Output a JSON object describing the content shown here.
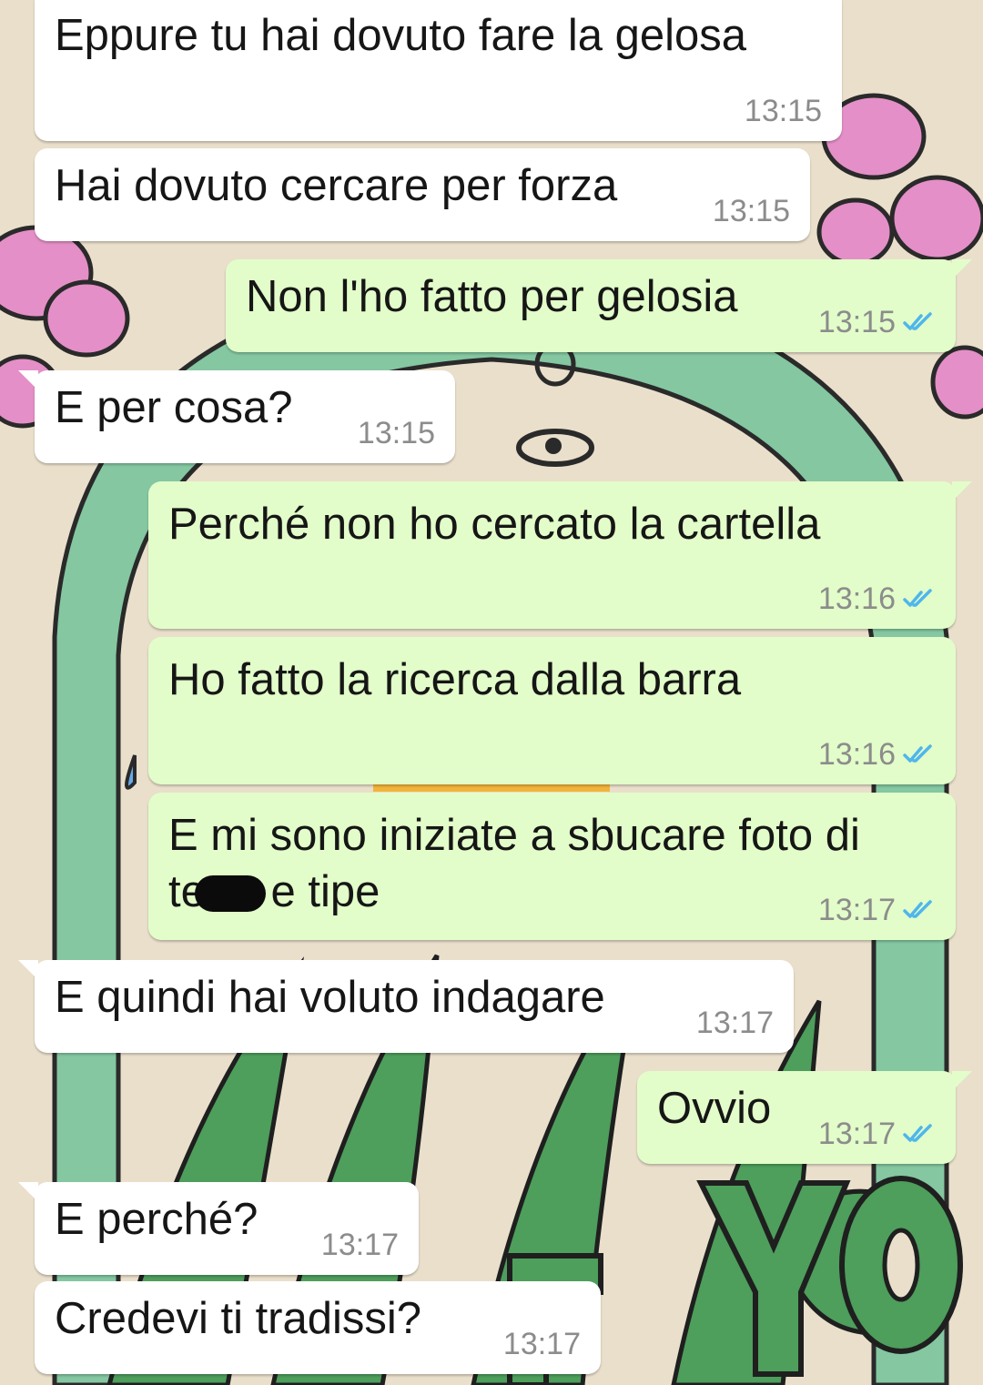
{
  "colors": {
    "incoming_bubble": "#ffffff",
    "outgoing_bubble": "#e2fdc9",
    "time_text": "#8c8c8c",
    "read_ticks": "#4fb6ec",
    "wallpaper_bg": "#e9dfcb"
  },
  "icons": {
    "read_receipt": "double-check-icon",
    "redaction": "redaction-mark"
  },
  "messages": [
    {
      "direction": "incoming",
      "text": "Eppure tu hai dovuto fare la gelosa",
      "time": "13:15"
    },
    {
      "direction": "incoming",
      "text": "Hai dovuto cercare per forza",
      "time": "13:15"
    },
    {
      "direction": "outgoing",
      "text": "Non l'ho fatto per gelosia",
      "time": "13:15",
      "read": true
    },
    {
      "direction": "incoming",
      "text": "E per cosa?",
      "time": "13:15"
    },
    {
      "direction": "outgoing",
      "text": "Perché non ho cercato la cartella",
      "time": "13:16",
      "read": true
    },
    {
      "direction": "outgoing",
      "text": "Ho fatto la ricerca dalla barra",
      "time": "13:16",
      "read": true
    },
    {
      "direction": "outgoing",
      "text": "E mi sono iniziate a sbucare foto di",
      "text_line2_start": "te",
      "text_line2_end": " e tipe",
      "time": "13:17",
      "read": true
    },
    {
      "direction": "incoming",
      "text": "E quindi hai voluto indagare",
      "time": "13:17"
    },
    {
      "direction": "outgoing",
      "text": "Ovvio",
      "time": "13:17",
      "read": true
    },
    {
      "direction": "incoming",
      "text": "E perché?",
      "time": "13:17"
    },
    {
      "direction": "incoming",
      "text": "Credevi ti tradissi?",
      "time": "13:17"
    }
  ]
}
